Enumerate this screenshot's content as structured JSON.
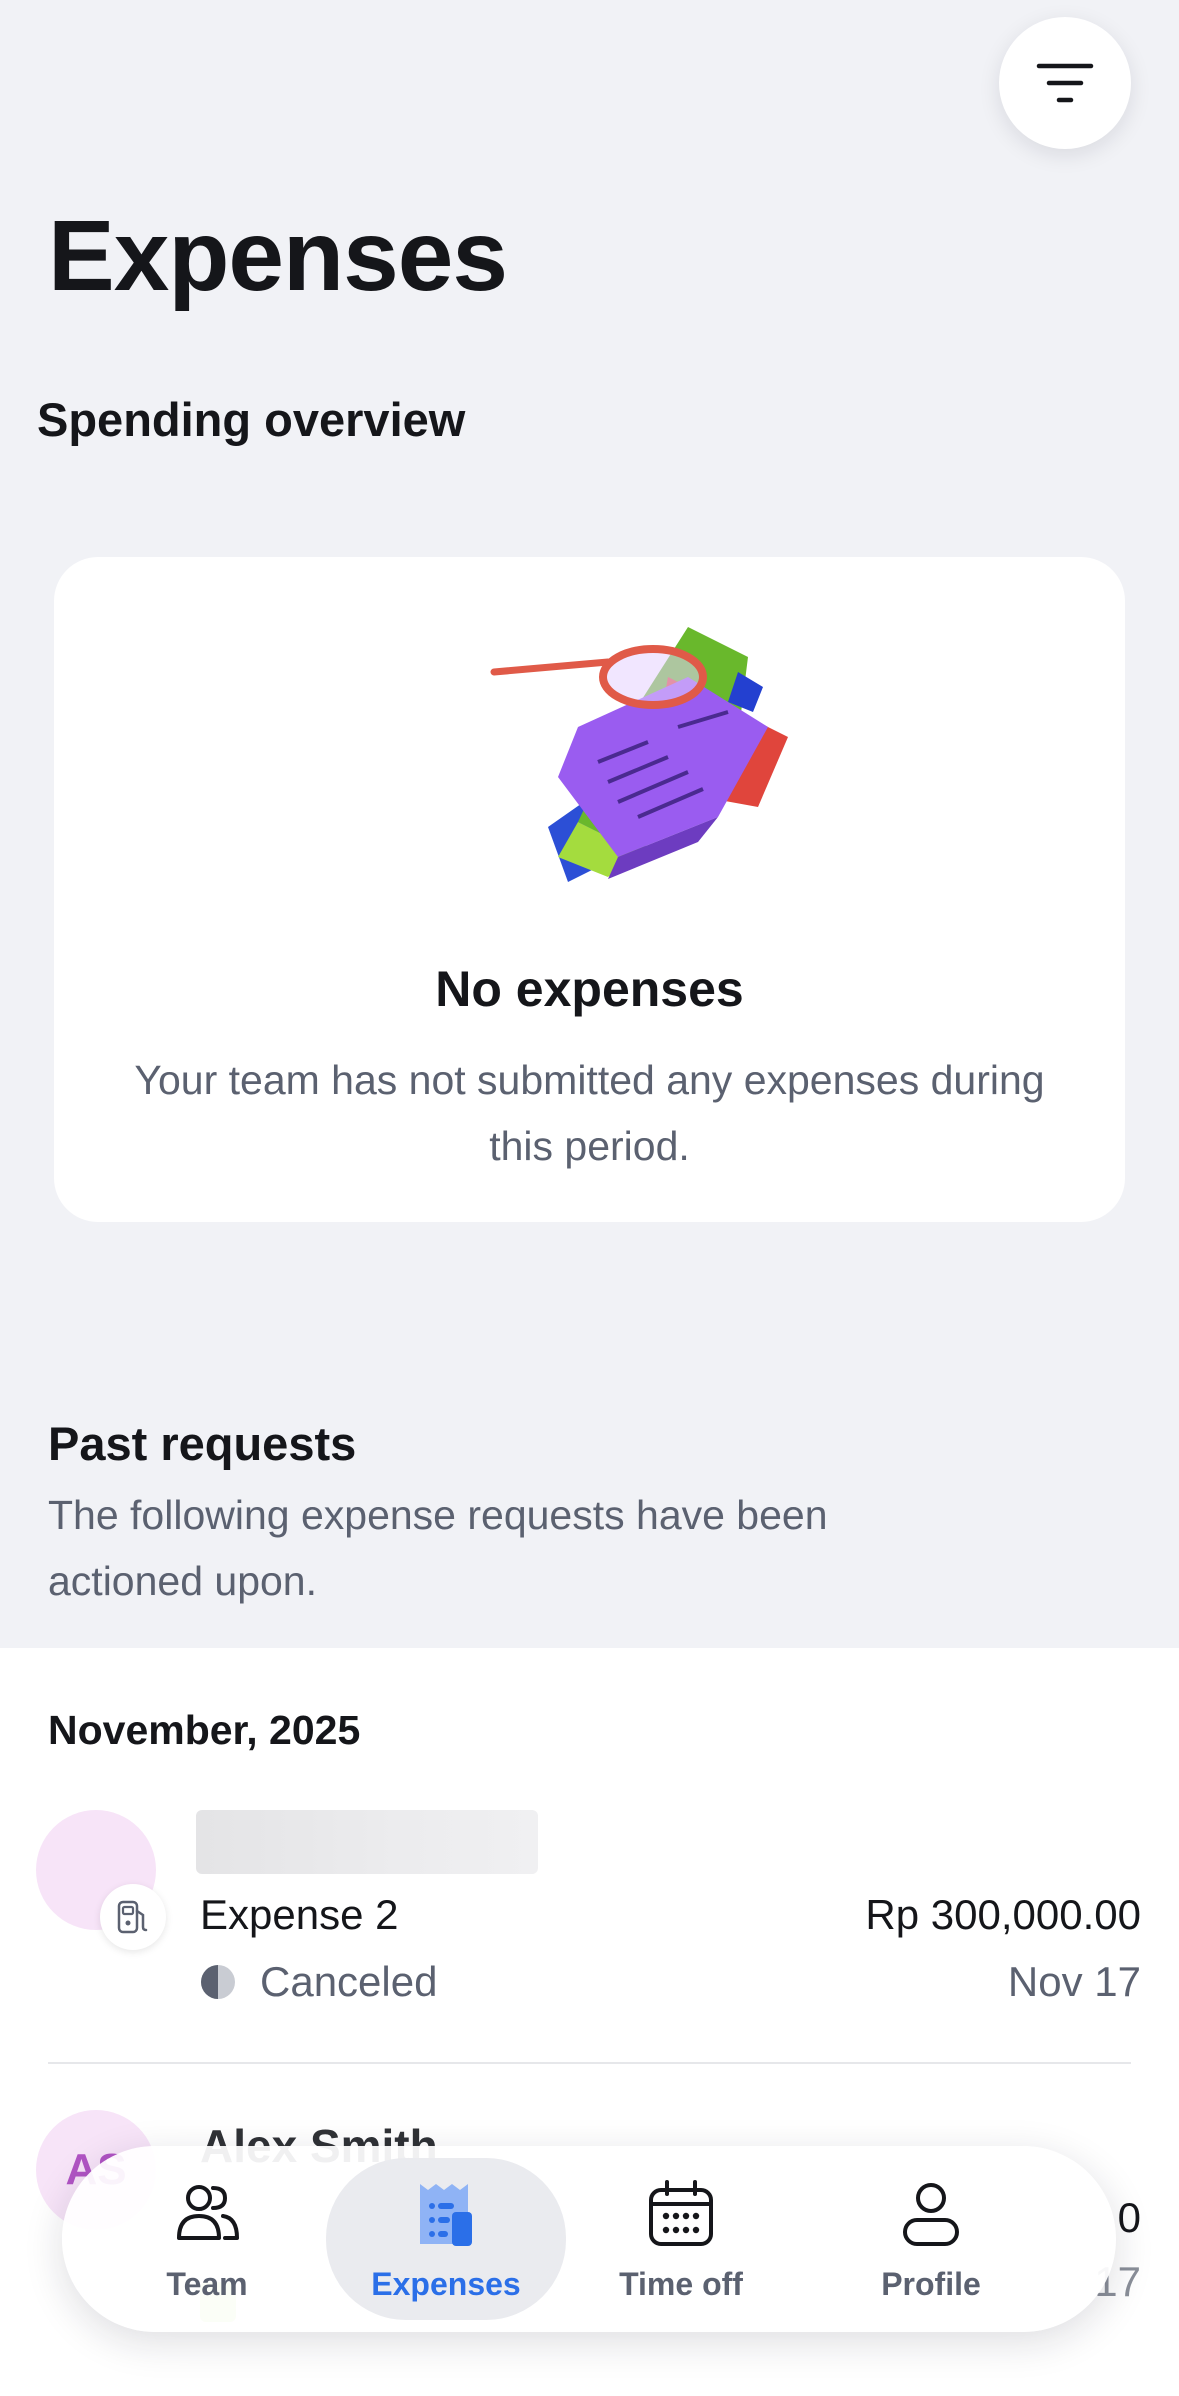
{
  "header": {
    "title": "Expenses",
    "filter_icon": "filter-lines-icon"
  },
  "spending_overview": {
    "heading": "Spending overview",
    "empty_state": {
      "illustration": "empty-search-documents-illustration",
      "title": "No expenses",
      "message": "Your team has not submitted any expenses during this period."
    }
  },
  "past_requests": {
    "heading": "Past requests",
    "subtitle": "The following expense requests have been actioned upon.",
    "groups": [
      {
        "month": "November, 2025",
        "items": [
          {
            "avatar_initials": "",
            "category_icon": "fuel-pump-icon",
            "title": "Expense 2",
            "amount": "Rp 300,000.00",
            "status": "Canceled",
            "status_color": "#5b6170",
            "date": "Nov 17"
          },
          {
            "avatar_initials": "AS",
            "name": "Alex Smith",
            "amount_visible": "0",
            "date_visible": "17"
          }
        ]
      }
    ]
  },
  "bottom_nav": {
    "active": "Expenses",
    "accent_color": "#2b6fe8",
    "items": [
      {
        "label": "Team",
        "icon": "team-icon"
      },
      {
        "label": "Expenses",
        "icon": "receipt-icon"
      },
      {
        "label": "Time off",
        "icon": "calendar-icon"
      },
      {
        "label": "Profile",
        "icon": "profile-icon"
      }
    ]
  }
}
